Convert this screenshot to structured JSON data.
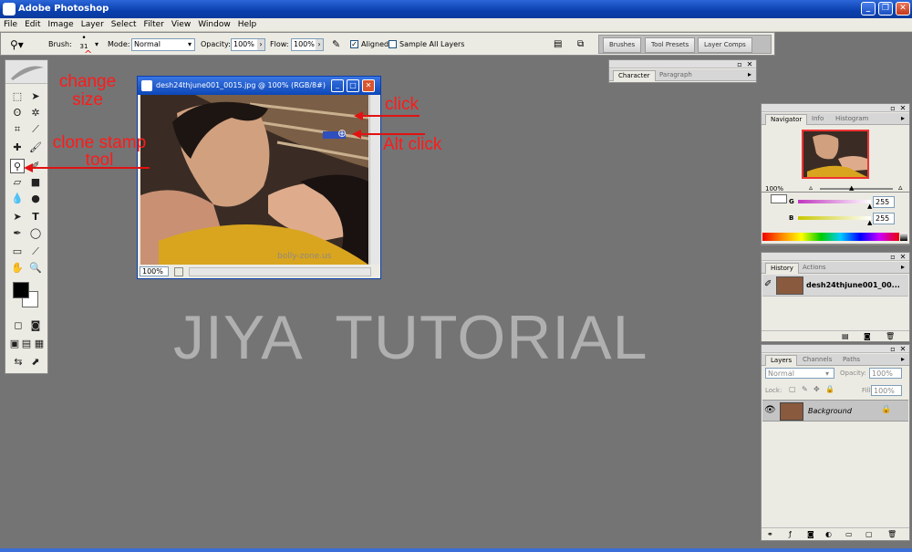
{
  "app": {
    "title": "Adobe Photoshop"
  },
  "window_controls": {
    "minimize": "_",
    "restore": "❐",
    "close": "✕"
  },
  "menu": [
    "File",
    "Edit",
    "Image",
    "Layer",
    "Select",
    "Filter",
    "View",
    "Window",
    "Help"
  ],
  "options": {
    "brush_label": "Brush:",
    "brush_size": "31",
    "mode_label": "Mode:",
    "mode_value": "Normal",
    "opacity_label": "Opacity:",
    "opacity_value": "100%",
    "flow_label": "Flow:",
    "flow_value": "100%",
    "aligned_label": "Aligned",
    "aligned_checked": "✓",
    "sample_all_label": "Sample All Layers",
    "wells": [
      "Brushes",
      "Tool Presets",
      "Layer Comps"
    ]
  },
  "document": {
    "title": "desh24thjune001_0015.jpg @ 100% (RGB/8#)",
    "zoom": "100%",
    "image_watermark": "bolly-zone.us"
  },
  "character_panel": {
    "tabs": [
      "Character",
      "Paragraph"
    ]
  },
  "navigator_panel": {
    "tabs": [
      "Navigator",
      "Info",
      "Histogram"
    ],
    "zoom": "100%"
  },
  "color_panel": {
    "channels": [
      {
        "label": "G",
        "value": "255"
      },
      {
        "label": "B",
        "value": "255"
      }
    ]
  },
  "history_panel": {
    "tabs": [
      "History",
      "Actions"
    ],
    "snapshot_name": "desh24thjune001_00..."
  },
  "layers_panel": {
    "tabs": [
      "Layers",
      "Channels",
      "Paths"
    ],
    "blend_mode": "Normal",
    "opacity_label": "Opacity:",
    "opacity_value": "100%",
    "lock_label": "Lock:",
    "fill_label": "Fill:",
    "fill_value": "100%",
    "layer_name": "Background"
  },
  "annotations": {
    "change_size": "change\nsize",
    "clone_stamp": "clone stamp\ntool",
    "click": "click",
    "alt_click": "Alt click",
    "watermark": "JIYA  TUTORIAL"
  },
  "colors": {
    "annotation_red": "#ff1a1a",
    "workspace_gray": "#747474",
    "title_blue": "#0a3fae"
  }
}
